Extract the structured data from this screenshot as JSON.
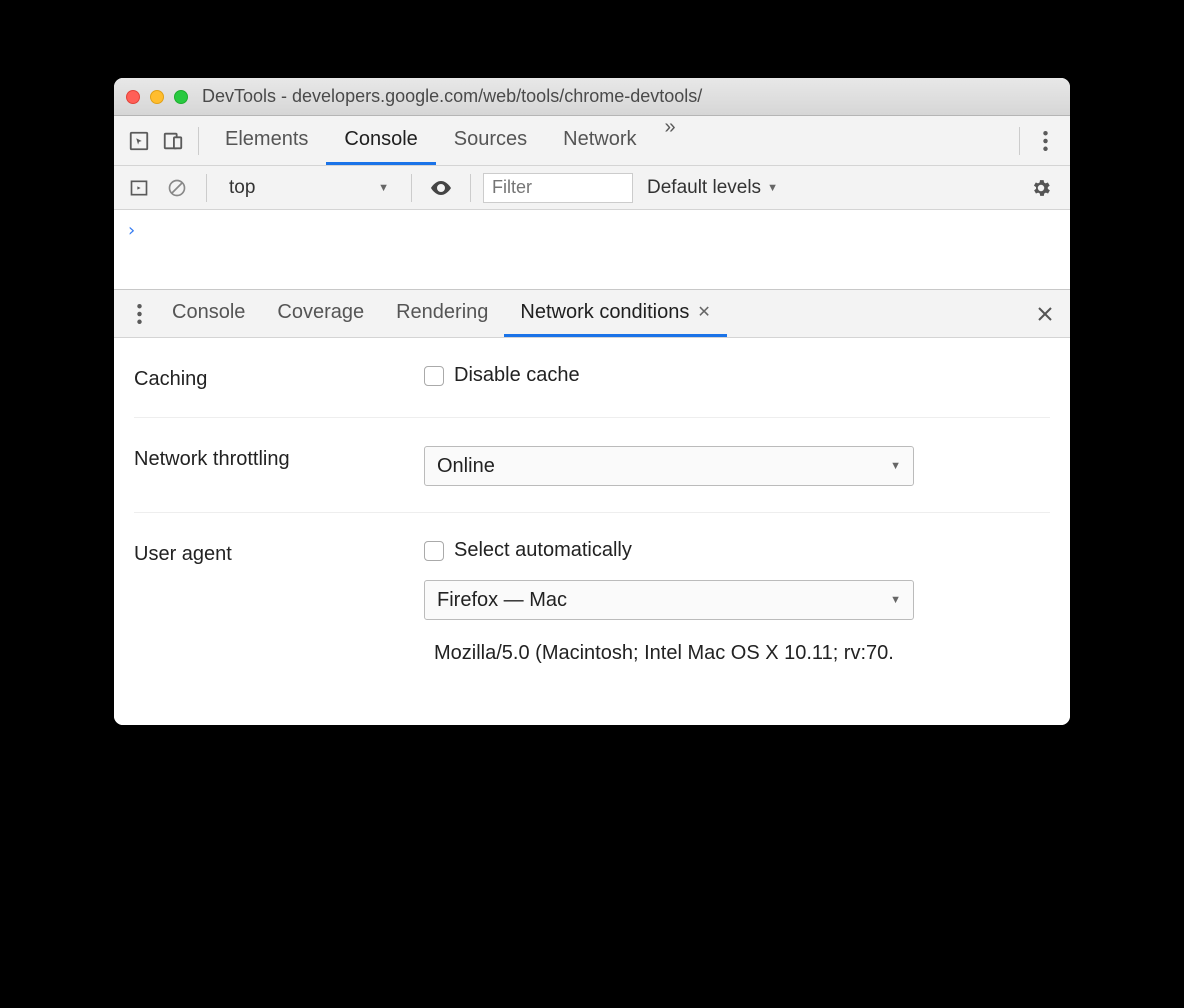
{
  "window": {
    "title": "DevTools - developers.google.com/web/tools/chrome-devtools/"
  },
  "mainTabs": {
    "items": [
      "Elements",
      "Console",
      "Sources",
      "Network"
    ],
    "active": "Console",
    "overflow": "»"
  },
  "consoleBar": {
    "context": "top",
    "filter_placeholder": "Filter",
    "levels": "Default levels"
  },
  "console": {
    "prompt": "›"
  },
  "drawer": {
    "tabs": [
      "Console",
      "Coverage",
      "Rendering",
      "Network conditions"
    ],
    "active": "Network conditions"
  },
  "netcond": {
    "caching_label": "Caching",
    "disable_cache": "Disable cache",
    "throttling_label": "Network throttling",
    "throttling_value": "Online",
    "ua_label": "User agent",
    "ua_auto": "Select automatically",
    "ua_value": "Firefox — Mac",
    "ua_string": "Mozilla/5.0 (Macintosh; Intel Mac OS X 10.11; rv:70."
  }
}
